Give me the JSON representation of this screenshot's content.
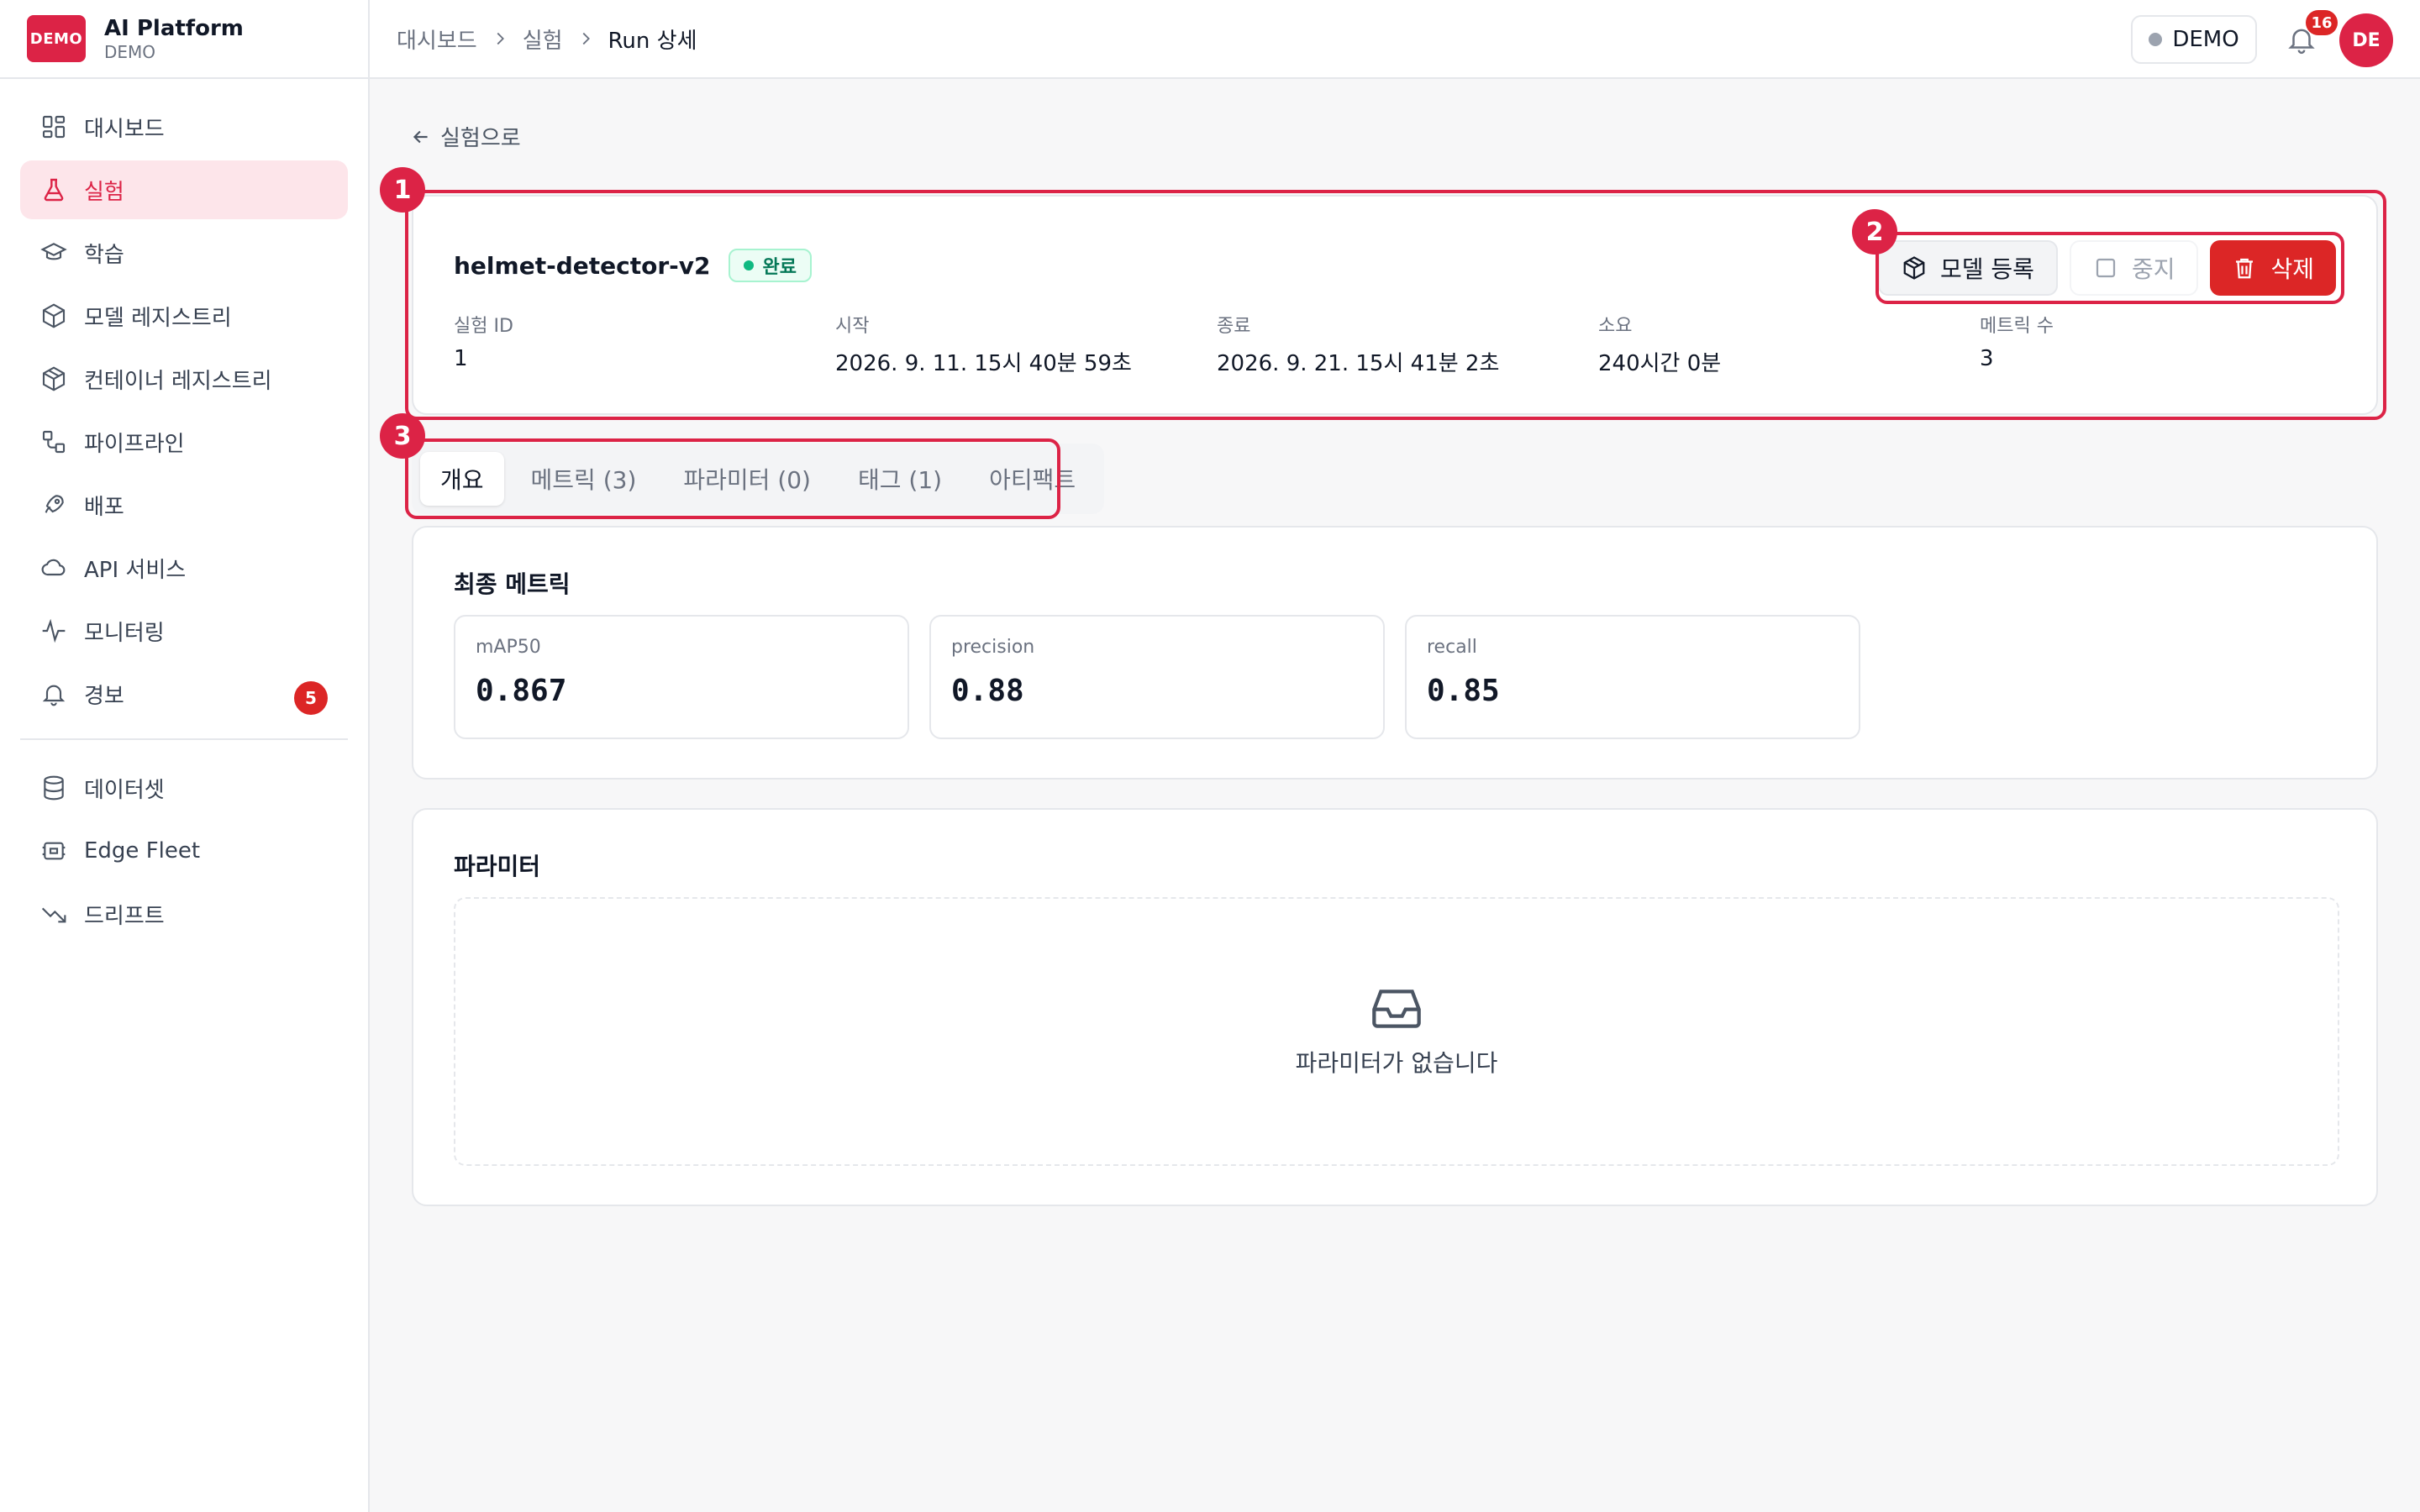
{
  "brand": {
    "logo_text": "DEMO",
    "title": "AI Platform",
    "subtitle": "DEMO"
  },
  "sidebar": {
    "items": [
      {
        "label": "대시보드",
        "icon": "dashboard-grid-icon",
        "active": false
      },
      {
        "label": "실험",
        "icon": "flask-icon",
        "active": true
      },
      {
        "label": "학습",
        "icon": "graduation-cap-icon",
        "active": false
      },
      {
        "label": "모델 레지스트리",
        "icon": "cube-icon",
        "active": false
      },
      {
        "label": "컨테이너 레지스트리",
        "icon": "boxes-icon",
        "active": false
      },
      {
        "label": "파이프라인",
        "icon": "workflow-icon",
        "active": false
      },
      {
        "label": "배포",
        "icon": "rocket-icon",
        "active": false
      },
      {
        "label": "API 서비스",
        "icon": "cloud-icon",
        "active": false
      },
      {
        "label": "모니터링",
        "icon": "activity-icon",
        "active": false
      },
      {
        "label": "경보",
        "icon": "bell-icon",
        "active": false,
        "badge": "5"
      }
    ],
    "secondary": [
      {
        "label": "데이터셋",
        "icon": "database-icon"
      },
      {
        "label": "Edge Fleet",
        "icon": "chip-icon"
      },
      {
        "label": "드리프트",
        "icon": "trend-down-icon"
      }
    ]
  },
  "header": {
    "breadcrumbs": [
      "대시보드",
      "실험",
      "Run 상세"
    ],
    "env_label": "DEMO",
    "notification_count": "16",
    "avatar_initials": "DE"
  },
  "main": {
    "back_label": "실험으로",
    "run": {
      "name": "helmet-detector-v2",
      "status": "완료",
      "meta": [
        {
          "label": "실험 ID",
          "value": "1"
        },
        {
          "label": "시작",
          "value": "2026. 9. 11. 15시 40분 59초"
        },
        {
          "label": "종료",
          "value": "2026. 9. 21. 15시 41분 2초"
        },
        {
          "label": "소요",
          "value": "240시간 0분"
        },
        {
          "label": "메트릭 수",
          "value": "3"
        }
      ],
      "actions": {
        "register": "모델 등록",
        "stop": "중지",
        "delete": "삭제"
      }
    },
    "tabs": [
      {
        "label": "개요",
        "active": true
      },
      {
        "label": "메트릭 (3)",
        "active": false
      },
      {
        "label": "파라미터 (0)",
        "active": false
      },
      {
        "label": "태그 (1)",
        "active": false
      },
      {
        "label": "아티팩트",
        "active": false
      }
    ],
    "final_metrics": {
      "title": "최종 메트릭",
      "items": [
        {
          "label": "mAP50",
          "value": "0.867"
        },
        {
          "label": "precision",
          "value": "0.88"
        },
        {
          "label": "recall",
          "value": "0.85"
        }
      ]
    },
    "params": {
      "title": "파라미터",
      "empty_text": "파라미터가 없습니다"
    }
  },
  "annotations": [
    "1",
    "2",
    "3"
  ],
  "colors": {
    "accent": "#dc2346",
    "danger": "#dc2626",
    "success": "#10b981"
  }
}
